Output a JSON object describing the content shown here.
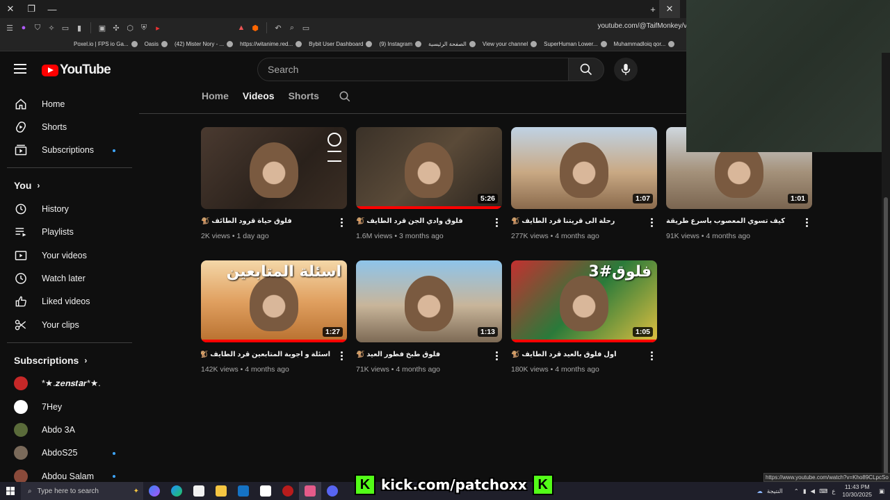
{
  "browser": {
    "url": "youtube.com/@TaifMonkey/v",
    "bookmarks": [
      {
        "label": "Poxel.io | FPS io Ga..."
      },
      {
        "label": "Oasis"
      },
      {
        "label": "(42) Mister Nory - ..."
      },
      {
        "label": "https://witanime.red..."
      },
      {
        "label": "Bybit User Dashboard"
      },
      {
        "label": "(9) Instagram"
      },
      {
        "label": "الصفحة الرئيسية"
      },
      {
        "label": "View your channel"
      },
      {
        "label": "SuperHuman Lower..."
      },
      {
        "label": "Muhammadloiq qor..."
      }
    ],
    "status_url": "https://www.youtube.com/watch?v=Kho89CLpcSo"
  },
  "header": {
    "logo_text": "YouTube",
    "search_placeholder": "Search"
  },
  "sidebar": {
    "main": [
      {
        "label": "Home",
        "icon": "home-icon"
      },
      {
        "label": "Shorts",
        "icon": "shorts-icon"
      },
      {
        "label": "Subscriptions",
        "icon": "subscriptions-icon",
        "dot": true
      }
    ],
    "you_heading": "You",
    "you": [
      {
        "label": "History",
        "icon": "history-icon"
      },
      {
        "label": "Playlists",
        "icon": "playlists-icon"
      },
      {
        "label": "Your videos",
        "icon": "your-videos-icon"
      },
      {
        "label": "Watch later",
        "icon": "watch-later-icon"
      },
      {
        "label": "Liked videos",
        "icon": "like-icon"
      },
      {
        "label": "Your clips",
        "icon": "scissors-icon"
      }
    ],
    "subs_heading": "Subscriptions",
    "subs": [
      {
        "label": "*★.𝒛𝒆𝒏𝒔𝒕𝒂𝒓*★.",
        "color": "#c62828"
      },
      {
        "label": "7Hey",
        "color": "#ffffff"
      },
      {
        "label": "Abdo 3A",
        "color": "#5a6b3a"
      },
      {
        "label": "AbdoS25",
        "color": "#7a6a5a",
        "dot": true
      },
      {
        "label": "Abdou Salam",
        "color": "#8a4a3a",
        "dot": true
      }
    ]
  },
  "channel_tabs": [
    {
      "label": "Home",
      "active": false
    },
    {
      "label": "Videos",
      "active": true
    },
    {
      "label": "Shorts",
      "active": false
    }
  ],
  "videos": [
    {
      "title": "فلوق حياة قرود الطائف 🐒",
      "views": "2K views",
      "age": "1 day ago",
      "duration": "",
      "progress": 0,
      "bg": "linear-gradient(135deg,#4a3a30,#2a211b 60%,#3b2e24)"
    },
    {
      "title": "فلوق وادي الجن قرد الطايف 🐒",
      "views": "1.6M views",
      "age": "3 months ago",
      "duration": "5:26",
      "progress": 1.0,
      "bg": "linear-gradient(135deg,#3a3128,#5a4a38 50%,#2a241e)"
    },
    {
      "title": "رحلة الى قريتنا قرد الطايف 🐒",
      "views": "277K views",
      "age": "4 months ago",
      "duration": "1:07",
      "progress": 0,
      "bg": "linear-gradient(180deg,#bfd2e4,#c9a984 55%,#8a6a4c)"
    },
    {
      "title": "كيف تسوي المعصوب بأسرع طريقة",
      "views": "91K views",
      "age": "4 months ago",
      "duration": "1:01",
      "progress": 0,
      "bg": "linear-gradient(180deg,#cfd7de,#a4917a 55%,#7a6550)"
    },
    {
      "title": "اسئلة و أجوبة المتابعين قرد الطايف 🐒",
      "views": "142K views",
      "age": "4 months ago",
      "duration": "1:27",
      "progress": 1.0,
      "bg": "linear-gradient(180deg,#f4d7a8,#e0a060 50%,#b8702f)",
      "overlay": "اسئلة المتابعين"
    },
    {
      "title": "فلوق طبخ فطور العيد 🐒",
      "views": "71K views",
      "age": "4 months ago",
      "duration": "1:13",
      "progress": 0,
      "bg": "linear-gradient(180deg,#8ec4ea,#c8b59a 55%,#7d6a55)"
    },
    {
      "title": "أول فلوق بالعيد قرد الطايف 🐒",
      "views": "180K views",
      "age": "4 months ago",
      "duration": "1:05",
      "progress": 1.0,
      "bg": "linear-gradient(135deg,#c43030,#2a7a3a 50%,#e0c040)",
      "overlay": "فلوق#3"
    }
  ],
  "taskbar": {
    "search_placeholder": "Type here to search",
    "weather": "النتيجة",
    "time": "11:43 PM",
    "date": "10/30/2025",
    "kick_text": "kick.com/patchoxx"
  }
}
